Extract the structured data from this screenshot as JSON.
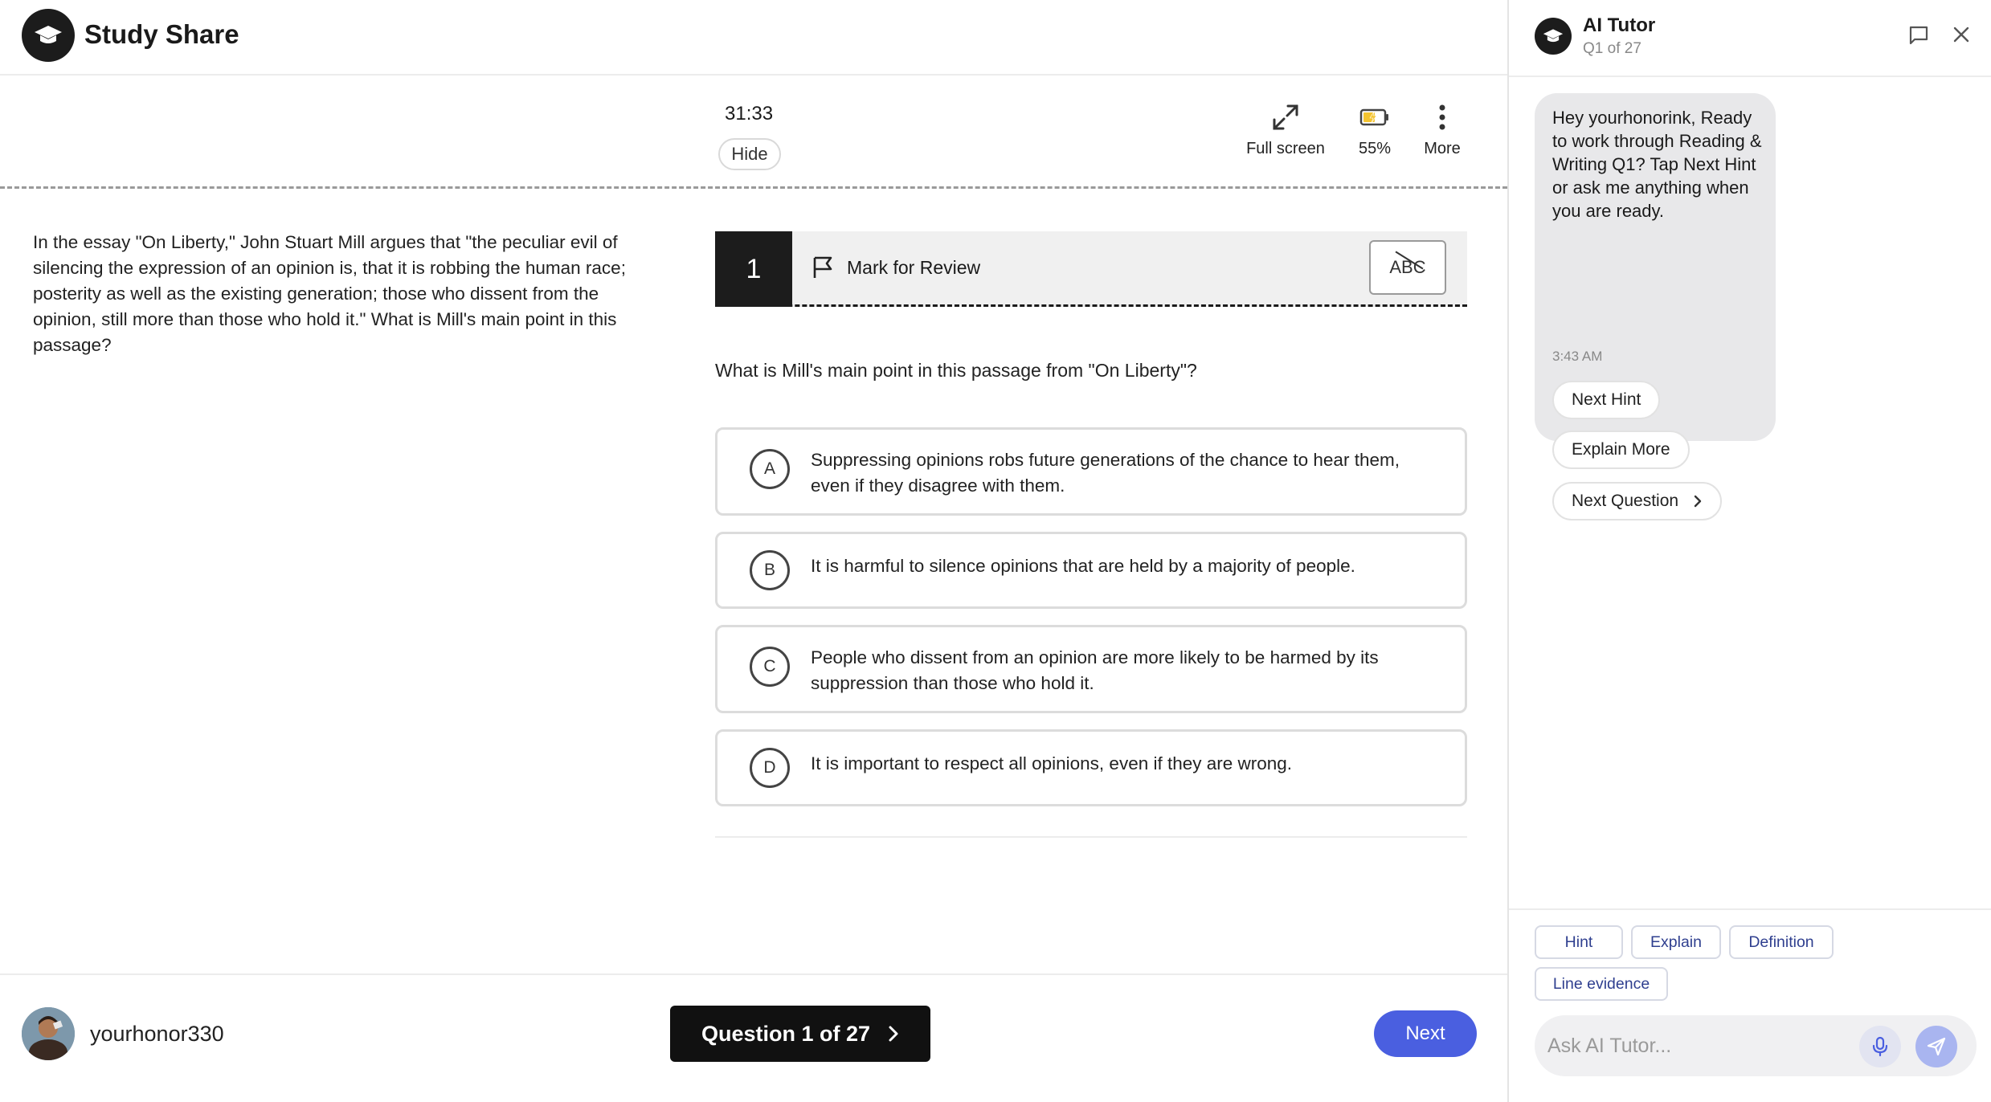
{
  "app": {
    "brand_name": "Study Share",
    "logo_icon": "graduation-cap-icon"
  },
  "toolbar": {
    "timer": "31:33",
    "hide_label": "Hide",
    "fullscreen_label": "Full screen",
    "battery_label": "55%",
    "battery_level": 0.55,
    "more_label": "More"
  },
  "passage": {
    "text": "In the essay \"On Liberty,\" John Stuart Mill argues that \"the peculiar evil of silencing the expression of an opinion is, that it is robbing the human race; posterity as well as the existing generation; those who dissent from the opinion, still more than those who hold it.\" What is Mill's main point in this passage?"
  },
  "question": {
    "number": "1",
    "mark_for_review_label": "Mark for Review",
    "abc_label": "ABC",
    "text": "What is Mill's main point in this passage from \"On Liberty\"?",
    "choices": [
      {
        "letter": "A",
        "text": "Suppressing opinions robs future generations of the chance to hear them, even if they disagree with them."
      },
      {
        "letter": "B",
        "text": "It is harmful to silence opinions that are held by a majority of people."
      },
      {
        "letter": "C",
        "text": "People who dissent from an opinion are more likely to be harmed by its suppression than those who hold it."
      },
      {
        "letter": "D",
        "text": "It is important to respect all opinions, even if they are wrong."
      }
    ]
  },
  "bottom": {
    "username": "yourhonor330",
    "question_nav_label": "Question 1 of 27",
    "next_label": "Next"
  },
  "tutor": {
    "title": "AI Tutor",
    "subtitle": "Q1 of 27",
    "message": "Hey yourhonorink, Ready to work through Reading & Writing Q1? Tap Next Hint or ask me anything when you are ready.",
    "message_time": "3:43 AM",
    "next_hint_label": "Next Hint",
    "explain_more_label": "Explain More",
    "next_question_label": "Next Question",
    "chips": {
      "hint": "Hint",
      "explain": "Explain",
      "definition": "Definition",
      "line_evidence": "Line evidence"
    },
    "input_placeholder": "Ask AI Tutor...",
    "accent_color": "#4a5fe0"
  }
}
